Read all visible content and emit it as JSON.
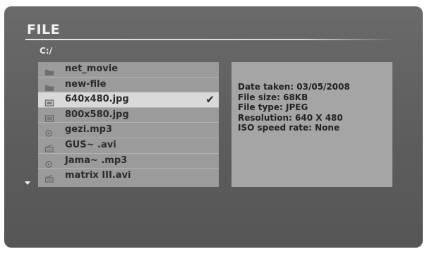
{
  "header": {
    "title": "FILE"
  },
  "path": "C:/",
  "files": [
    {
      "name": "net_movie",
      "icon": "folder-icon",
      "selected": false
    },
    {
      "name": "new-file",
      "icon": "folder-icon",
      "selected": false
    },
    {
      "name": "640x480.jpg",
      "icon": "image-icon",
      "selected": true
    },
    {
      "name": "800x580.jpg",
      "icon": "image-icon",
      "selected": false
    },
    {
      "name": "gezi.mp3",
      "icon": "music-icon",
      "selected": false
    },
    {
      "name": "GUS~ .avi",
      "icon": "video-icon",
      "selected": false
    },
    {
      "name": "Jama~ .mp3",
      "icon": "music-icon",
      "selected": false
    },
    {
      "name": "matrix III.avi",
      "icon": "video-icon",
      "selected": false
    }
  ],
  "selection_mark": "✔",
  "details": [
    "Date taken: 03/05/2008",
    "File size: 68KB",
    "File type: JPEG",
    "Resolution: 640 X 480",
    "ISO speed rate: None"
  ],
  "colors": {
    "background": "#5f5f5f",
    "list_bg": "#9b9b9b",
    "selected_row": "#d9d9d9",
    "info_bg": "#a5a5a5"
  }
}
